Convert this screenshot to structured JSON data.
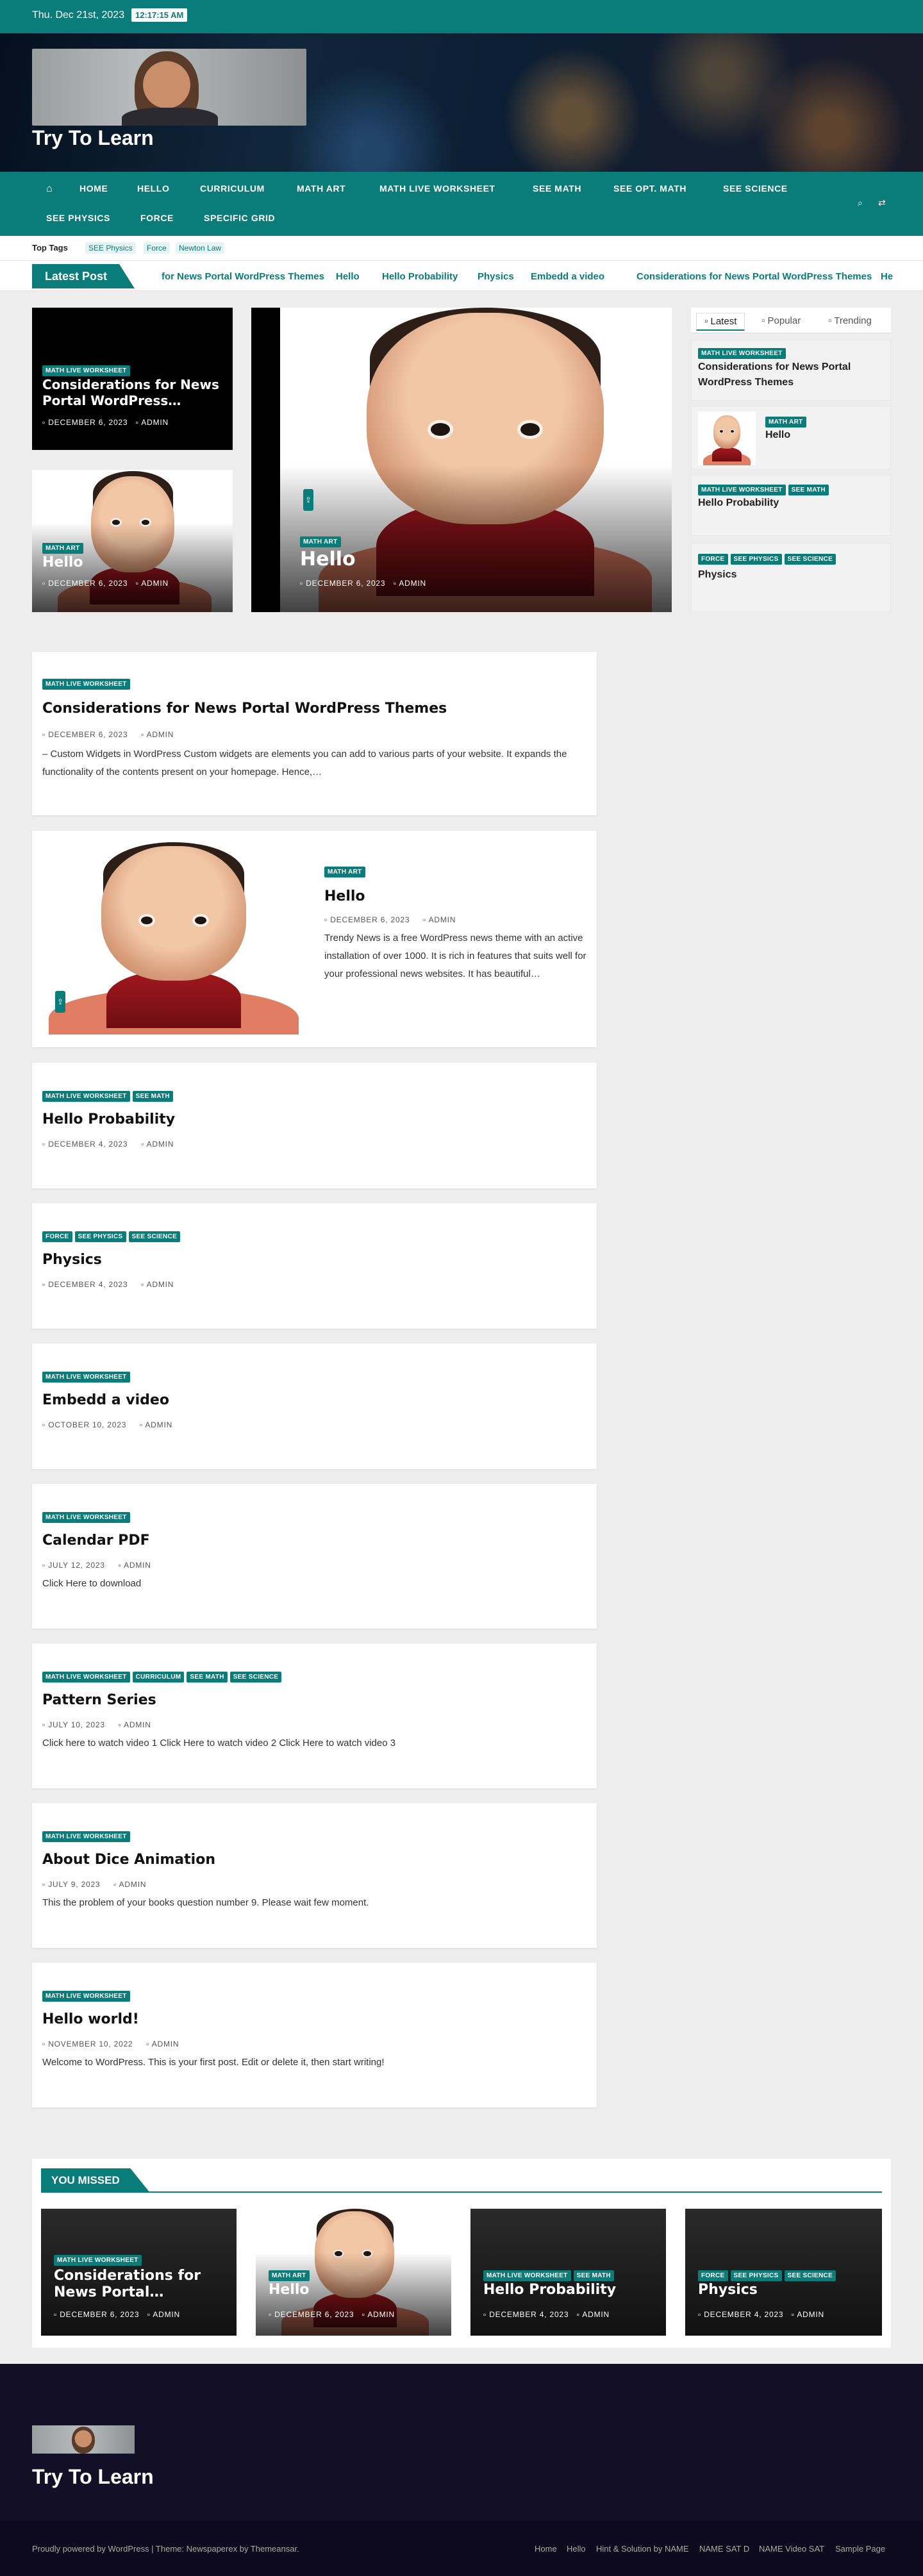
{
  "topbar": {
    "date": "Thu. Dec 21st, 2023",
    "time": "12:17:15 AM"
  },
  "site": {
    "title": "Try To Learn"
  },
  "nav": {
    "items": [
      "HOME",
      "HELLO",
      "CURRICULUM",
      "MATH ART",
      "MATH LIVE WORKSHEET",
      "SEE MATH",
      "SEE OPT. MATH",
      "SEE SCIENCE",
      "SEE PHYSICS",
      "FORCE",
      "SPECIFIC GRID"
    ]
  },
  "tags": {
    "label": "Top Tags",
    "items": [
      "SEE Physics",
      "Force",
      "Newton Law"
    ]
  },
  "ticker": {
    "label": "Latest Post",
    "items": [
      "for News Portal WordPress Themes",
      "Hello",
      "Hello Probability",
      "Physics",
      "Embedd a video",
      "Considerations for News Portal WordPress Themes",
      "He"
    ]
  },
  "featured": {
    "left1": {
      "cat": "MATH LIVE WORKSHEET",
      "title": "Considerations for News Portal WordPress…",
      "date": "DECEMBER 6, 2023",
      "author": "ADMIN"
    },
    "left2": {
      "cat": "MATH ART",
      "title": "Hello",
      "date": "DECEMBER 6, 2023",
      "author": "ADMIN"
    },
    "main": {
      "cat": "MATH ART",
      "title": "Hello",
      "date": "DECEMBER 6, 2023",
      "author": "ADMIN"
    }
  },
  "sidebar": {
    "tabs": [
      "Latest",
      "Popular",
      "Trending"
    ],
    "items": [
      {
        "cats": [
          "MATH LIVE WORKSHEET"
        ],
        "title": "Considerations for News Portal WordPress Themes"
      },
      {
        "cats": [
          "MATH ART"
        ],
        "title": "Hello"
      },
      {
        "cats": [
          "MATH LIVE WORKSHEET",
          "SEE MATH"
        ],
        "title": "Hello Probability"
      },
      {
        "cats": [
          "FORCE",
          "SEE PHYSICS",
          "SEE SCIENCE"
        ],
        "title": "Physics"
      }
    ]
  },
  "posts": [
    {
      "cats": [
        "MATH LIVE WORKSHEET"
      ],
      "title": "Considerations for News Portal WordPress Themes",
      "date": "DECEMBER 6, 2023",
      "author": "ADMIN",
      "excerpt": "– Custom Widgets in WordPress Custom widgets are elements you can add to various parts of your website. It expands the functionality of the contents present on your homepage.  Hence,…"
    },
    {
      "cats": [
        "MATH ART"
      ],
      "title": "Hello",
      "date": "DECEMBER 6, 2023",
      "author": "ADMIN",
      "excerpt": "Trendy News is a free WordPress news theme with an active installation of over 1000. It is rich in features that suits well for your professional news websites. It has beautiful…"
    },
    {
      "cats": [
        "MATH LIVE WORKSHEET",
        "SEE MATH"
      ],
      "title": "Hello Probability",
      "date": "DECEMBER 4, 2023",
      "author": "ADMIN",
      "excerpt": ""
    },
    {
      "cats": [
        "FORCE",
        "SEE PHYSICS",
        "SEE SCIENCE"
      ],
      "title": "Physics",
      "date": "DECEMBER 4, 2023",
      "author": "ADMIN",
      "excerpt": ""
    },
    {
      "cats": [
        "MATH LIVE WORKSHEET"
      ],
      "title": "Embedd a video",
      "date": "OCTOBER 10, 2023",
      "author": "ADMIN",
      "excerpt": ""
    },
    {
      "cats": [
        "MATH LIVE WORKSHEET"
      ],
      "title": "Calendar PDF",
      "date": "JULY 12, 2023",
      "author": "ADMIN",
      "excerpt": "Click Here to download"
    },
    {
      "cats": [
        "MATH LIVE WORKSHEET",
        "CURRICULUM",
        "SEE MATH",
        "SEE SCIENCE"
      ],
      "title": "Pattern Series",
      "date": "JULY 10, 2023",
      "author": "ADMIN",
      "excerpt": "Click here to watch video 1 Click Here to watch video 2 Click Here to watch video 3"
    },
    {
      "cats": [
        "MATH LIVE WORKSHEET"
      ],
      "title": "About Dice Animation",
      "date": "JULY 9, 2023",
      "author": "ADMIN",
      "excerpt": "This the problem of your books question number 9. Please wait few moment."
    },
    {
      "cats": [
        "MATH LIVE WORKSHEET"
      ],
      "title": "Hello world!",
      "date": "NOVEMBER 10, 2022",
      "author": "ADMIN",
      "excerpt": "Welcome to WordPress. This is your first post. Edit or delete it, then start writing!"
    }
  ],
  "missed": {
    "heading": "YOU MISSED",
    "items": [
      {
        "cats": [
          "MATH LIVE WORKSHEET"
        ],
        "title": "Considerations for News Portal…",
        "date": "DECEMBER 6, 2023",
        "author": "ADMIN"
      },
      {
        "cats": [
          "MATH ART"
        ],
        "title": "Hello",
        "date": "DECEMBER 6, 2023",
        "author": "ADMIN"
      },
      {
        "cats": [
          "MATH LIVE WORKSHEET",
          "SEE MATH"
        ],
        "title": "Hello Probability",
        "date": "DECEMBER 4, 2023",
        "author": "ADMIN"
      },
      {
        "cats": [
          "FORCE",
          "SEE PHYSICS",
          "SEE SCIENCE"
        ],
        "title": "Physics",
        "date": "DECEMBER 4, 2023",
        "author": "ADMIN"
      }
    ]
  },
  "footer": {
    "title": "Try To Learn",
    "credit": "Proudly powered by WordPress | Theme: Newspaperex by Themeansar.",
    "links": [
      "Home",
      "Hello",
      "Hint & Solution by NAME",
      "NAME SAT D",
      "NAME Video SAT",
      "Sample Page"
    ]
  },
  "colors": {
    "accent": "#0a7c79",
    "footer_bg": "#120f26"
  }
}
